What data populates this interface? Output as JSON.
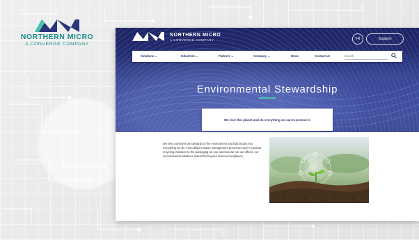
{
  "brand": {
    "name": "NORTHERN MICRO",
    "subtitle": "A CONVERGE COMPANY",
    "color": "#1c8c8c"
  },
  "site": {
    "brand_name": "NORTHERN MICRO",
    "brand_subtitle": "A CONVERGE COMPANY",
    "lang_label": "FR",
    "support_label": "Support",
    "nav": [
      {
        "label": "Solutions ⌄"
      },
      {
        "label": "Industries ⌄"
      },
      {
        "label": "Partners ⌄"
      },
      {
        "label": "Company ⌄"
      },
      {
        "label": "News"
      },
      {
        "label": "Contact Us"
      }
    ],
    "search_placeholder": "Search",
    "hero_title": "Environmental Stewardship",
    "tagline": "We love this planet and do everything we can to protect it.",
    "body": "We view ourselves as stewards of the environment and that factors into everything we do. From diligent waste management processes and IT product recycling initiatives to the packaging we use and how we run our offices, our environmental initiatives extend far beyond minimal compliance.",
    "colors": {
      "navy": "#2a357e",
      "accent": "#48c4a8"
    },
    "icons": [
      "search-icon",
      "plant-sprout-image"
    ]
  }
}
